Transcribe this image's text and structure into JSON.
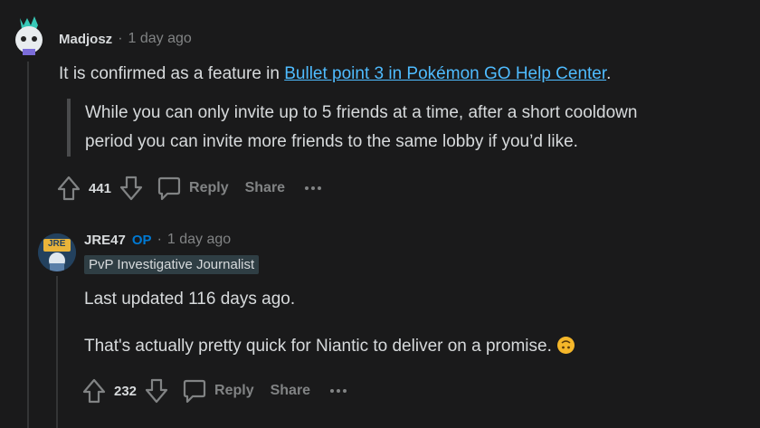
{
  "comment1": {
    "author": "Madjosz",
    "time": "1 day ago",
    "text_before_link": "It is confirmed as a feature in ",
    "link_text": "Bullet point 3 in Pokémon GO Help Center",
    "text_after_link": ".",
    "quote_line1": "While you can only invite up to 5 friends at a time, after a short cooldown",
    "quote_line2": "period you can invite more friends to the same lobby if you’d like.",
    "votes": "441",
    "reply_label": "Reply",
    "share_label": "Share"
  },
  "comment2": {
    "author": "JRE47",
    "op_label": "OP",
    "time": "1 day ago",
    "flair": "PvP Investigative Journalist",
    "avatar_text": "JRE",
    "paragraph1": "Last updated 116 days ago.",
    "paragraph2": "That's actually pretty quick for Niantic to deliver on a promise.",
    "votes": "232",
    "reply_label": "Reply",
    "share_label": "Share"
  },
  "colors": {
    "background": "#1a1a1b",
    "link": "#4fbcff",
    "op": "#0079d3",
    "muted": "#818384"
  }
}
